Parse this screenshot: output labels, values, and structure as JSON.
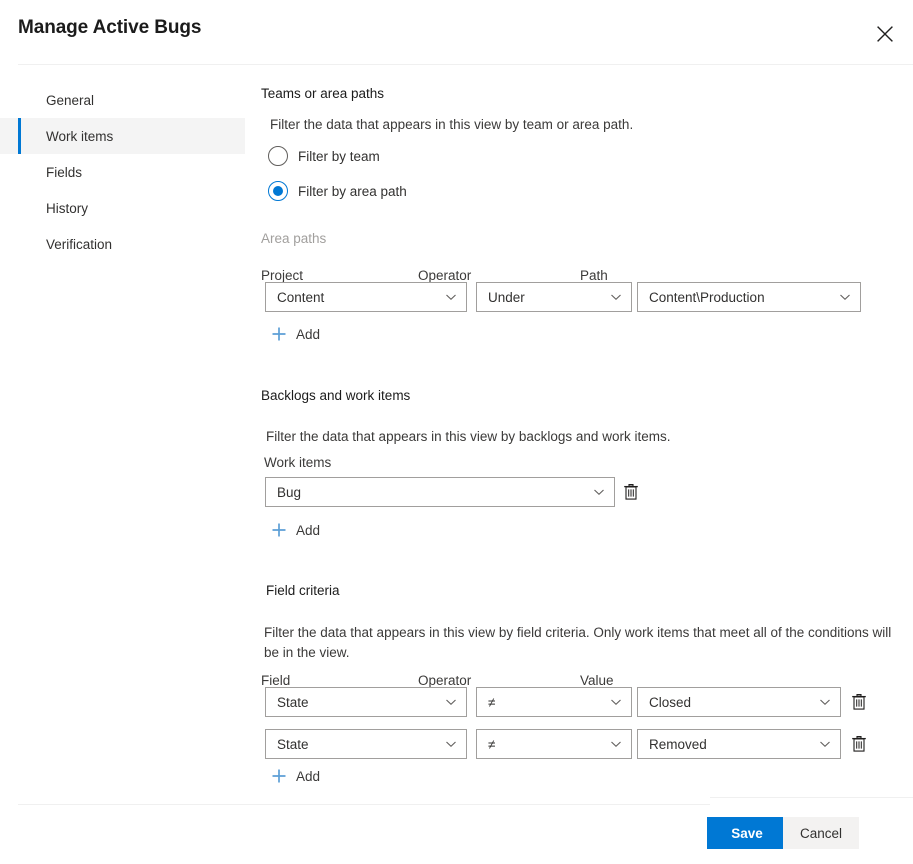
{
  "dialog": {
    "title": "Manage Active Bugs",
    "close_icon": "close-icon"
  },
  "sidebar": {
    "items": [
      {
        "label": "General",
        "selected": false
      },
      {
        "label": "Work items",
        "selected": true
      },
      {
        "label": "Fields",
        "selected": false
      },
      {
        "label": "History",
        "selected": false
      },
      {
        "label": "Verification",
        "selected": false
      }
    ]
  },
  "teams_or_area_paths": {
    "title": "Teams or area paths",
    "description": "Filter the data that appears in this view by team or area path.",
    "options": [
      {
        "label": "Filter by team",
        "selected": false
      },
      {
        "label": "Filter by area path",
        "selected": true
      }
    ]
  },
  "area_paths": {
    "label": "Area paths",
    "columns": {
      "project": "Project",
      "operator": "Operator",
      "path": "Path"
    },
    "rows": [
      {
        "project": "Content",
        "operator": "Under",
        "path": "Content\\Production"
      }
    ],
    "add_label": "Add"
  },
  "backlogs_and_work_items": {
    "title": "Backlogs and work items",
    "description": "Filter the data that appears in this view by backlogs and work items.",
    "field_label": "Work items",
    "rows": [
      {
        "value": "Bug"
      }
    ],
    "add_label": "Add",
    "delete_icon": "trash-icon"
  },
  "field_criteria": {
    "title": "Field criteria",
    "description": "Filter the data that appears in this view by field criteria. Only work items that meet all of the conditions will be in the view.",
    "columns": {
      "field": "Field",
      "operator": "Operator",
      "value": "Value"
    },
    "rows": [
      {
        "field": "State",
        "operator": "≠",
        "value": "Closed"
      },
      {
        "field": "State",
        "operator": "≠",
        "value": "Removed"
      }
    ],
    "add_label": "Add",
    "delete_icon": "trash-icon"
  },
  "footer": {
    "save_label": "Save",
    "cancel_label": "Cancel"
  },
  "colors": {
    "accent": "#0078d4",
    "selected_nav_bg": "#f4f4f4",
    "border": "#a19f9d",
    "divider": "#f0f0f0",
    "text": "#323130",
    "muted_text": "#a19f9d",
    "add_icon": "#5c9fd6",
    "secondary_button_bg": "#f3f2f1"
  }
}
